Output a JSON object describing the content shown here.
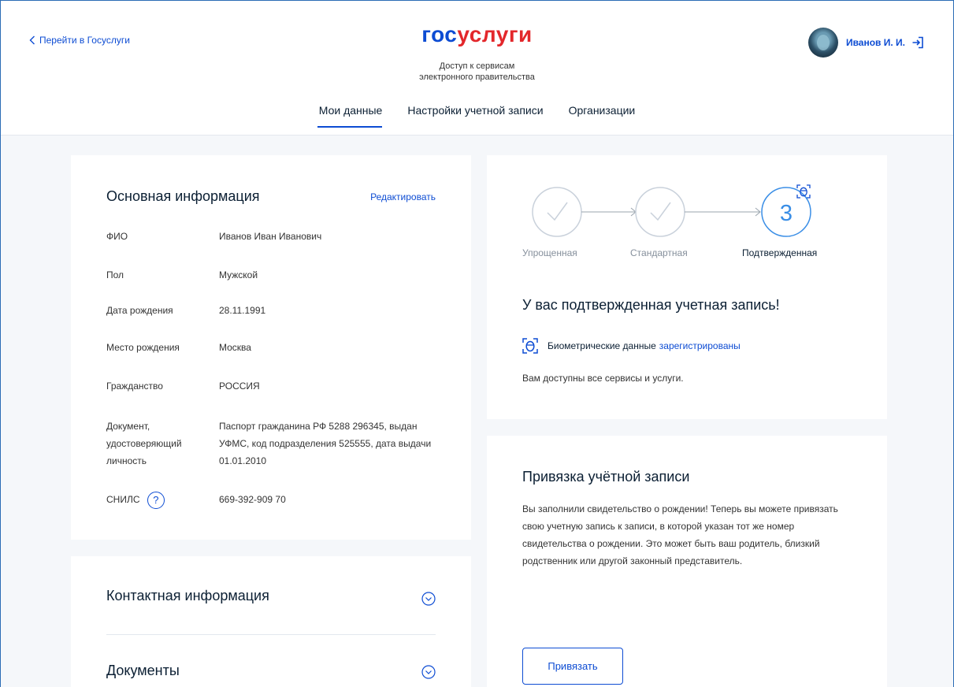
{
  "header": {
    "back_link": "Перейти в Госуслуги",
    "logo_part1": "гос",
    "logo_part2": "услуги",
    "subtitle_line1": "Доступ к сервисам",
    "subtitle_line2": "электронного правительства",
    "user_name": "Иванов И. И."
  },
  "tabs": [
    {
      "label": "Мои данные",
      "active": true
    },
    {
      "label": "Настройки учетной записи",
      "active": false
    },
    {
      "label": "Организации",
      "active": false
    }
  ],
  "main_info": {
    "title": "Основная информация",
    "edit_label": "Редактировать",
    "rows": [
      {
        "label": "ФИО",
        "value": "Иванов Иван Иванович"
      },
      {
        "label": "Пол",
        "value": "Мужской"
      },
      {
        "label": "Дата рождения",
        "value": "28.11.1991"
      },
      {
        "label": "Место рождения",
        "value": "Москва"
      },
      {
        "label": "Гражданство",
        "value": "РОССИЯ"
      },
      {
        "label": "Документ, удостоверяющий личность",
        "value": "Паспорт гражданина РФ 5288 296345, выдан УФМС, код подразделения 525555, дата выдачи 01.01.2010"
      },
      {
        "label": "СНИЛС",
        "value": "669-392-909 70"
      }
    ],
    "help_glyph": "?"
  },
  "accordion": {
    "contacts_title": "Контактная информация",
    "documents_title": "Документы"
  },
  "status": {
    "steps": [
      {
        "label": "Упрощенная",
        "state": "done"
      },
      {
        "label": "Стандартная",
        "state": "done"
      },
      {
        "label": "Подтвержденная",
        "state": "current",
        "number": "3"
      }
    ],
    "title": "У вас подтвержденная учетная запись!",
    "bio_text": "Биометрические данные",
    "bio_link": "зарегистрированы",
    "note": "Вам доступны все сервисы и услуги."
  },
  "link_account": {
    "title": "Привязка учётной записи",
    "description": "Вы заполнили свидетельство о рождении! Теперь вы можете привязать свою учетную запись к записи, в которой указан тот же номер свидетельства о рождении. Это может быть ваш родитель, близкий родственник или другой законный представитель.",
    "button": "Привязать"
  },
  "colors": {
    "accent": "#0d4cd3",
    "logo_red": "#e3272b",
    "background": "#f5f7fa",
    "muted": "#86909c",
    "step_circle": "#c9d1db",
    "current_step": "#3a8ee6"
  },
  "icons": [
    "chevron-left-icon",
    "logout-icon",
    "help-icon",
    "check-icon",
    "arrow-right-icon",
    "face-scan-icon",
    "chevron-down-circle-icon"
  ]
}
